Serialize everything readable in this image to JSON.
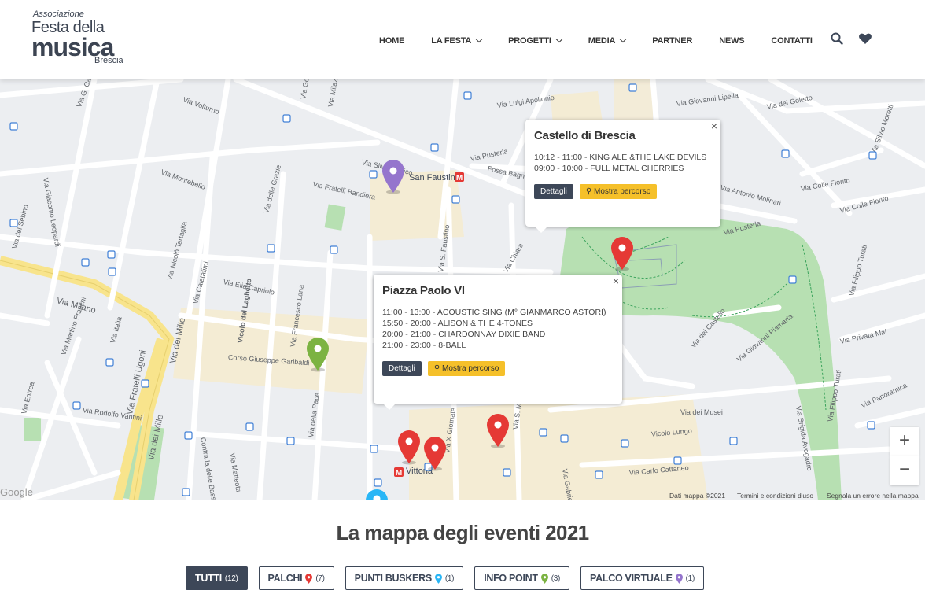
{
  "logo": {
    "line1": "Associazione",
    "line2": "Festa della",
    "line3": "musica",
    "line4": "Brescia"
  },
  "nav": [
    {
      "label": "HOME",
      "dropdown": false
    },
    {
      "label": "LA FESTA",
      "dropdown": true
    },
    {
      "label": "PROGETTI",
      "dropdown": true
    },
    {
      "label": "MEDIA",
      "dropdown": true
    },
    {
      "label": "PARTNER",
      "dropdown": false
    },
    {
      "label": "NEWS",
      "dropdown": false
    },
    {
      "label": "CONTATTI",
      "dropdown": false
    }
  ],
  "header_icons": [
    "search-icon",
    "heart-icon"
  ],
  "map": {
    "streets": [
      "Via Volturno",
      "Via Golgi",
      "Via Milazzo",
      "Via Luigi Apollonio",
      "Via Giovanni Lipella",
      "Via del Goletto",
      "Via Silvio Moretti",
      "Via Giacomo Leopardi",
      "Via G. Camozzi",
      "Via Montebello",
      "Via Fratelli Bandiera",
      "Via delle Grazie",
      "Via Silvio Pellico",
      "San Faustino",
      "Fossa Bagni",
      "Via Pusterla",
      "Via Antonio Molinari",
      "Via Colle Fiorito",
      "Via Colle Fiorito",
      "Via del Sebino",
      "Via Nicolò Tartaglia",
      "Via Calatafimi",
      "Via Elia Capriolo",
      "Via S. Faustino",
      "Via Chiara",
      "Via Pusterla",
      "Via Filippo Turati",
      "Via Milano",
      "Via Martino Franchi",
      "Vicolo del Laghetto",
      "Via Francesco Lana",
      "Via del Castello",
      "Via Giovanni Piamarta",
      "Via Privata Mai",
      "Corso Giuseppe Garibaldi",
      "Via Fratelli Ugoni",
      "Via dei Mille",
      "Via Italia",
      "Via Rodolfo Vantini",
      "Via Entrea",
      "Via della Pace",
      "Via Brigida Avogadro",
      "Via Filippo Turati",
      "Via Panoramica",
      "Via dei Musei",
      "Vicolo Lungo",
      "Contrada delle Bassiche",
      "Via Matteotti",
      "Via X Giornate",
      "Vittoria",
      "Via Carlo Cattaneo",
      "Via Gabriele Rosa",
      "Via S. Maria",
      "Via dei Mille"
    ],
    "attribution": [
      "Dati mappa ©2021",
      "Termini e condizioni d'uso",
      "Segnala un errore nella mappa"
    ],
    "google_label": "Google",
    "popups": [
      {
        "title": "Castello di Brescia",
        "events": [
          "10:12 - 11:00 - KING ALE &THE LAKE DEVILS",
          "09:00 - 10:00 - FULL METAL CHERRIES"
        ],
        "details": "Dettagli",
        "route": "Mostra percorso"
      },
      {
        "title": "Piazza Paolo VI",
        "events": [
          "11:00 - 13:00 - ACOUSTIC SING (M° GIANMARCO ASTORI)",
          "15:50 - 20:00 - ALISON & THE 4-TONES",
          "20:00 - 21:00 - CHARDONNAY DIXIE BAND",
          "21:00 - 23:00 - 8-BALL"
        ],
        "details": "Dettagli",
        "route": "Mostra percorso"
      }
    ],
    "close_glyph": "×",
    "zoom_in": "+",
    "zoom_out": "−",
    "colors": {
      "stage": "#e53935",
      "busker": "#29b6f6",
      "info": "#7cb342",
      "virtual": "#9575cd",
      "park": "#b7e0b2"
    }
  },
  "section": {
    "title": "La mappa degli eventi 2021"
  },
  "filters": [
    {
      "label": "TUTTI",
      "count": "(12)",
      "active": true,
      "pin": ""
    },
    {
      "label": "PALCHI",
      "count": "(7)",
      "active": false,
      "pin": "#e53935"
    },
    {
      "label": "PUNTI BUSKERS",
      "count": "(1)",
      "active": false,
      "pin": "#29b6f6"
    },
    {
      "label": "INFO POINT",
      "count": "(3)",
      "active": false,
      "pin": "#7cb342"
    },
    {
      "label": "PALCO VIRTUALE",
      "count": "(1)",
      "active": false,
      "pin": "#9575cd"
    }
  ]
}
